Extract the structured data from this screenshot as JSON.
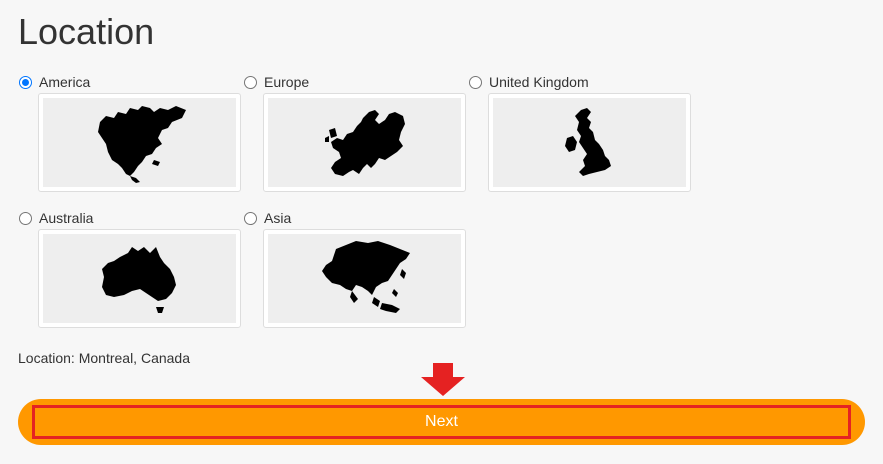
{
  "page": {
    "title": "Location"
  },
  "options": [
    {
      "label": "America",
      "checked": true,
      "icon": "north-america-map-icon"
    },
    {
      "label": "Europe",
      "checked": false,
      "icon": "europe-map-icon"
    },
    {
      "label": "United Kingdom",
      "checked": false,
      "icon": "united-kingdom-map-icon"
    },
    {
      "label": "Australia",
      "checked": false,
      "icon": "australia-map-icon"
    },
    {
      "label": "Asia",
      "checked": false,
      "icon": "asia-map-icon"
    }
  ],
  "location": {
    "text": "Location: Montreal, Canada"
  },
  "next": {
    "label": "Next"
  },
  "colors": {
    "accent": "#ff9800",
    "highlight": "#e52222",
    "radio_checked": "#0075ff"
  }
}
